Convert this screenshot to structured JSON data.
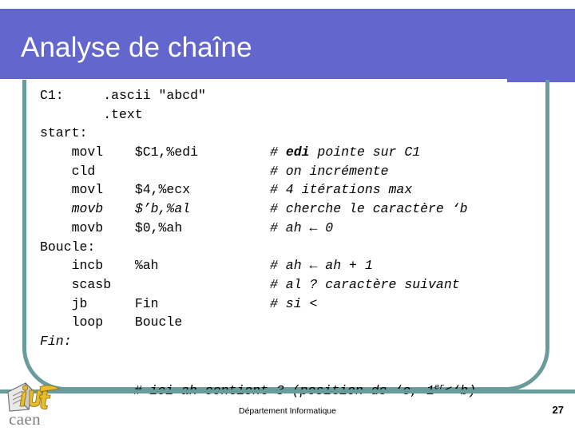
{
  "slide": {
    "title": "Analyse de chaîne",
    "accent_header": "#6366cc",
    "accent_frame": "#6b9c9c",
    "background": "#ffffff"
  },
  "code": {
    "language": "x86 assembly (AT&T)",
    "lines": [
      {
        "code": "C1:     .ascii \"abcd\"",
        "comment": "",
        "code_style": "normal",
        "comment_parts": []
      },
      {
        "code": "        .text",
        "comment": "",
        "code_style": "normal",
        "comment_parts": []
      },
      {
        "code": "start:",
        "comment": "",
        "code_style": "normal",
        "comment_parts": []
      },
      {
        "code": "    movl    $C1,%edi",
        "comment": "# edi pointe sur C1",
        "code_style": "normal",
        "comment_parts": [
          {
            "text": "# ",
            "style": "italic"
          },
          {
            "text": "edi",
            "style": "bold-italic"
          },
          {
            "text": " pointe sur C1",
            "style": "italic"
          }
        ]
      },
      {
        "code": "    cld",
        "comment": "# on incrémente",
        "code_style": "normal",
        "comment_parts": [
          {
            "text": "# on incrémente",
            "style": "italic"
          }
        ]
      },
      {
        "code": "    movl    $4,%ecx",
        "comment": "# 4 itérations max",
        "code_style": "normal",
        "comment_parts": [
          {
            "text": "# 4 itérations max",
            "style": "italic"
          }
        ]
      },
      {
        "code": "    movb    $’b,%al",
        "comment": "# cherche le caractère ‘b",
        "code_style": "italic",
        "comment_parts": [
          {
            "text": "# cherche le caractère ‘b",
            "style": "italic"
          }
        ]
      },
      {
        "code": "    movb    $0,%ah",
        "comment": "# ah ← 0",
        "code_style": "normal",
        "comment_parts": [
          {
            "text": "# ah ← 0",
            "style": "italic"
          }
        ]
      },
      {
        "code": "Boucle:",
        "comment": "",
        "code_style": "normal",
        "comment_parts": []
      },
      {
        "code": "    incb    %ah",
        "comment": "# ah ← ah + 1",
        "code_style": "normal",
        "comment_parts": [
          {
            "text": "# ah ← ah + 1",
            "style": "italic"
          }
        ]
      },
      {
        "code": "    scasb",
        "comment": "# al ? caractère suivant",
        "code_style": "normal",
        "comment_parts": [
          {
            "text": "# al ? caractère suivant",
            "style": "italic"
          }
        ]
      },
      {
        "code": "    jb      Fin",
        "comment": "# si <",
        "code_style": "normal",
        "comment_parts": [
          {
            "text": "# si <",
            "style": "italic"
          }
        ]
      },
      {
        "code": "    loop    Boucle",
        "comment": "",
        "code_style": "normal",
        "comment_parts": []
      },
      {
        "code": "Fin:",
        "comment": "",
        "code_style": "italic",
        "comment_parts": []
      }
    ]
  },
  "trailing_note": {
    "prefix": "# ici ah contient 3 (position de ‘c, 1",
    "superscript": "er",
    "suffix": "<‘b)"
  },
  "footer": {
    "department": "Département Informatique",
    "page_number": "27",
    "logo_word": "caen",
    "logo_mark": "iut-caen-logo"
  }
}
